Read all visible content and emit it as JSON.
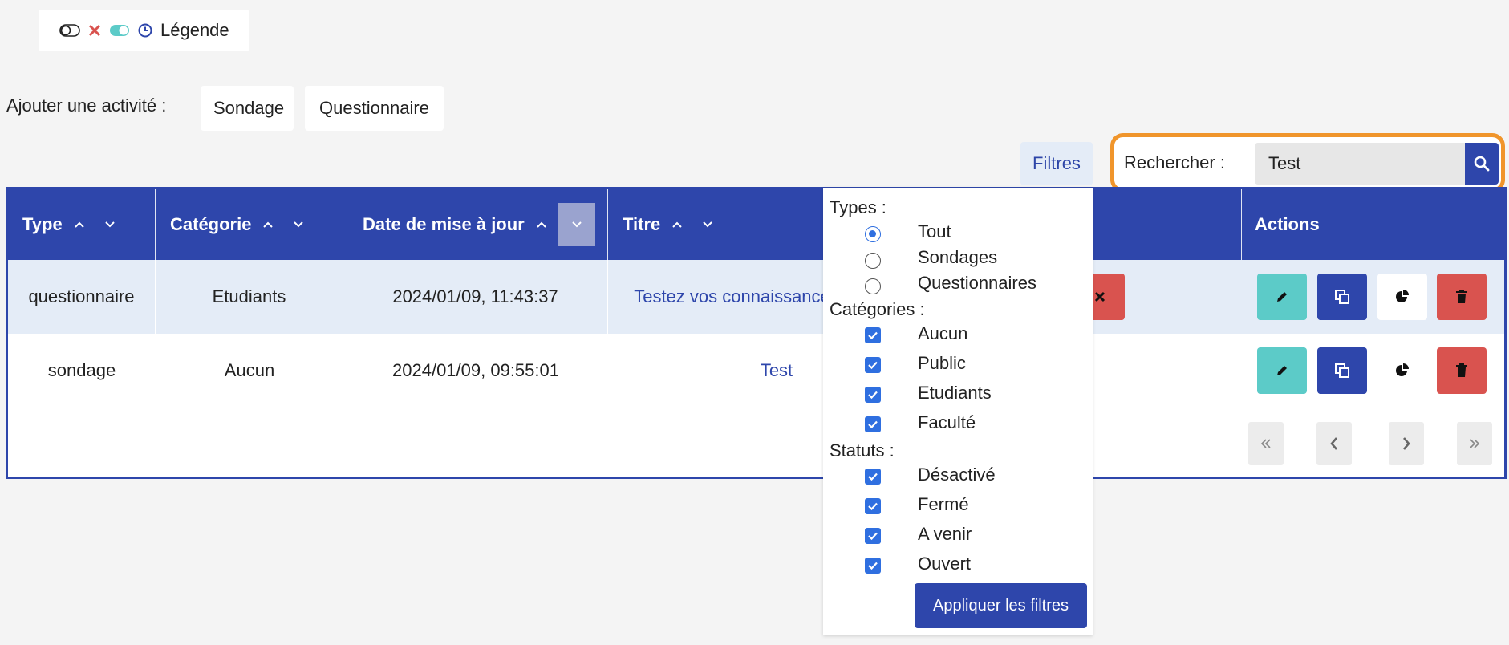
{
  "legend": {
    "label": "Légende"
  },
  "add_activity": {
    "label": "Ajouter une activité :",
    "survey_button": "Sondage",
    "quiz_button": "Questionnaire"
  },
  "toolbar": {
    "filters_label": "Filtres"
  },
  "search": {
    "label": "Rechercher :",
    "value": "Test"
  },
  "table": {
    "headers": {
      "type": "Type",
      "category": "Catégorie",
      "date": "Date de mise à jour",
      "title": "Titre",
      "actions": "Actions"
    },
    "rows": [
      {
        "type": "questionnaire",
        "category": "Etudiants",
        "date": "2024/01/09, 11:43:37",
        "title": "Testez vos connaissances"
      },
      {
        "type": "sondage",
        "category": "Aucun",
        "date": "2024/01/09, 09:55:01",
        "title": "Test"
      }
    ]
  },
  "filters": {
    "types_label": "Types :",
    "types": [
      "Tout",
      "Sondages",
      "Questionnaires"
    ],
    "selected_type": "Tout",
    "categories_label": "Catégories :",
    "categories": [
      "Aucun",
      "Public",
      "Etudiants",
      "Faculté"
    ],
    "statuses_label": "Statuts :",
    "statuses": [
      "Désactivé",
      "Fermé",
      "A venir",
      "Ouvert"
    ],
    "apply_button": "Appliquer les filtres"
  },
  "colors": {
    "primary": "#2e46ab",
    "teal": "#5ccbc8",
    "danger": "#d9534f",
    "highlight": "#f0952b",
    "row_alt": "#e4ecf7"
  }
}
